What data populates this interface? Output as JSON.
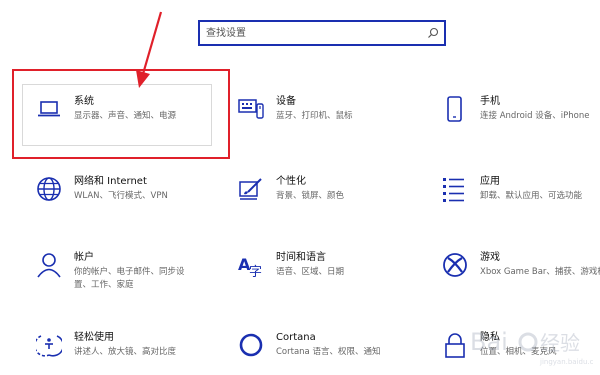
{
  "search": {
    "placeholder": "查找设置"
  },
  "tiles": [
    {
      "title": "系统",
      "desc": "显示器、声音、通知、电源",
      "icon": "laptop-icon"
    },
    {
      "title": "设备",
      "desc": "蓝牙、打印机、鼠标",
      "icon": "keyboard-icon"
    },
    {
      "title": "手机",
      "desc": "连接 Android 设备、iPhone",
      "icon": "phone-icon"
    },
    {
      "title": "网络和 Internet",
      "desc": "WLAN、飞行模式、VPN",
      "icon": "globe-icon"
    },
    {
      "title": "个性化",
      "desc": "背景、锁屏、颜色",
      "icon": "paint-icon"
    },
    {
      "title": "应用",
      "desc": "卸载、默认应用、可选功能",
      "icon": "apps-list-icon"
    },
    {
      "title": "帐户",
      "desc": "你的帐户、电子邮件、同步设置、工作、家庭",
      "icon": "person-icon"
    },
    {
      "title": "时间和语言",
      "desc": "语音、区域、日期",
      "icon": "time-language-icon"
    },
    {
      "title": "游戏",
      "desc": "Xbox Game Bar、捕获、游戏模式",
      "icon": "xbox-icon"
    },
    {
      "title": "轻松使用",
      "desc": "讲述人、放大镜、高对比度",
      "icon": "ease-of-access-icon"
    },
    {
      "title": "Cortana",
      "desc": "Cortana 语言、权限、通知",
      "icon": "cortana-icon"
    },
    {
      "title": "隐私",
      "desc": "位置、相机、麦克风",
      "icon": "lock-icon"
    }
  ],
  "colors": {
    "accent": "#1a2fb0",
    "annotation": "#e0202a"
  }
}
